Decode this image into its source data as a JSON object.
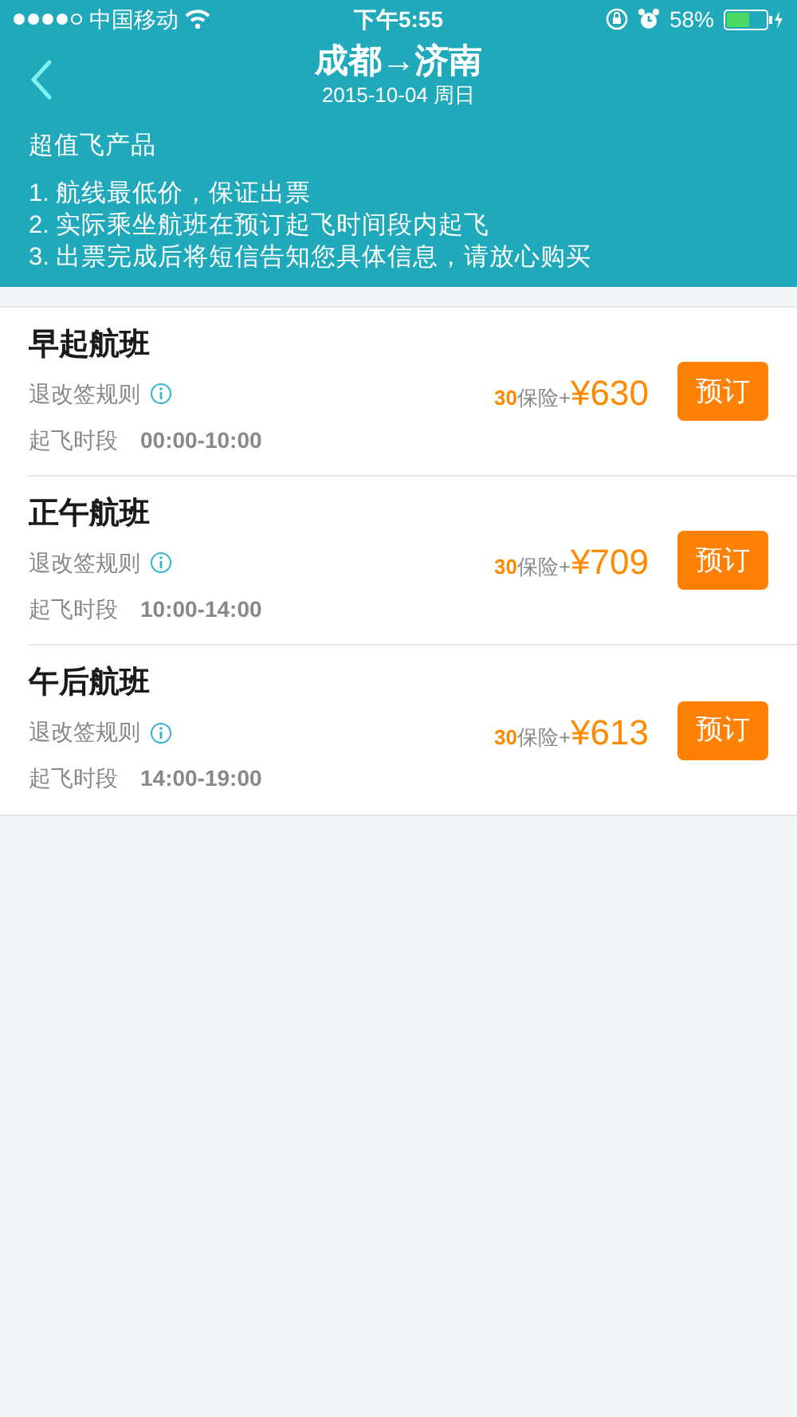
{
  "status_bar": {
    "carrier": "中国移动",
    "time": "下午5:55",
    "battery": "58%"
  },
  "nav": {
    "title": "成都→济南",
    "subtitle": "2015-10-04 周日"
  },
  "notice": {
    "heading": "超值飞产品",
    "lines": [
      "1. 航线最低价，保证出票",
      "2. 实际乘坐航班在预订起飞时间段内起飞",
      "3. 出票完成后将短信告知您具体信息，请放心购买"
    ]
  },
  "flights": [
    {
      "name": "早起航班",
      "rules": "退改签规则",
      "time_label": "起飞时段",
      "time_range": "00:00-10:00",
      "insurance": "30",
      "insurance_label": "保险+",
      "price": "¥630",
      "button": "预订"
    },
    {
      "name": "正午航班",
      "rules": "退改签规则",
      "time_label": "起飞时段",
      "time_range": "10:00-14:00",
      "insurance": "30",
      "insurance_label": "保险+",
      "price": "¥709",
      "button": "预订"
    },
    {
      "name": "午后航班",
      "rules": "退改签规则",
      "time_label": "起飞时段",
      "time_range": "14:00-19:00",
      "insurance": "30",
      "insurance_label": "保险+",
      "price": "¥613",
      "button": "预订"
    }
  ]
}
